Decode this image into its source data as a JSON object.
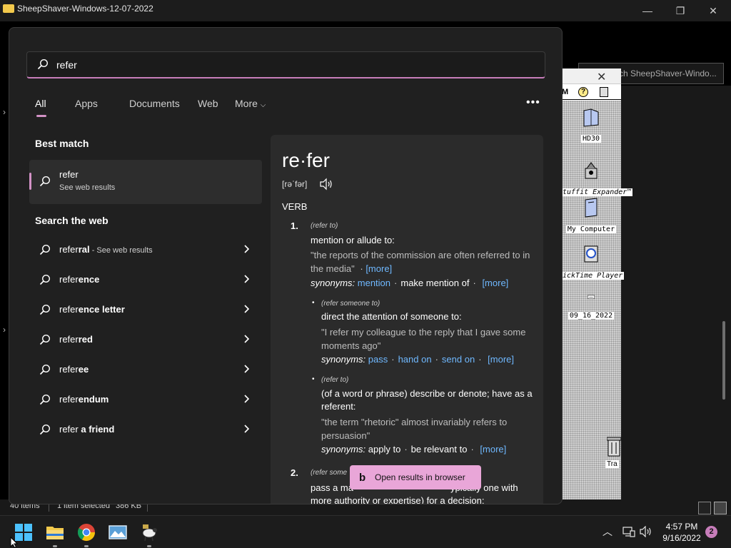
{
  "explorer": {
    "title": "SheepShaver-Windows-12-07-2022",
    "minimize": "—",
    "maximize": "❐",
    "close": "✕",
    "search_placeholder": "rch SheepShaver-Windo...",
    "status_items": "40 items",
    "status_selected": "1 item selected",
    "status_size": "386 KB"
  },
  "mac": {
    "menu_letter": "M",
    "help_glyph": "?",
    "close": "✕",
    "icons": [
      {
        "label": "HD30"
      },
      {
        "label": "tuffit Expander™"
      },
      {
        "label": "My Computer"
      },
      {
        "label": "ickTime Player"
      },
      {
        "label": "09_16_2022"
      }
    ],
    "trash_label": "Tra"
  },
  "search": {
    "query": "refer",
    "tabs": [
      "All",
      "Apps",
      "Documents",
      "Web",
      "More"
    ],
    "more_chevron": "⌵",
    "overflow": "•••",
    "best_match_title": "Best match",
    "best_match": {
      "title": "refer",
      "subtitle": "See web results"
    },
    "web_title": "Search the web",
    "web_items": [
      {
        "prefix": "refer",
        "rest": "ral",
        "sub": " - See web results"
      },
      {
        "prefix": "refer",
        "rest": "ence",
        "sub": ""
      },
      {
        "prefix": "refer",
        "rest": "ence letter",
        "sub": ""
      },
      {
        "prefix": "refer",
        "rest": "red",
        "sub": ""
      },
      {
        "prefix": "refer",
        "rest": "ee",
        "sub": ""
      },
      {
        "prefix": "refer",
        "rest": "endum",
        "sub": ""
      },
      {
        "prefix": "refer",
        "rest": " a friend",
        "sub": ""
      }
    ]
  },
  "dictionary": {
    "word": "re·fer",
    "pronunciation": "[rəˈfər]",
    "part_of_speech": "VERB",
    "sense1_num": "1.",
    "sense1_tag": "(refer to)",
    "sense1_def": "mention or allude to:",
    "sense1_example": "\"the reports of the commission are often referred to in the media\"",
    "more": "[more]",
    "synonyms_label": "synonyms:",
    "sense1_syn": [
      "mention",
      "make mention of"
    ],
    "sub1_tag": "(refer someone to)",
    "sub1_def": "direct the attention of someone to:",
    "sub1_example": "\"I refer my colleague to the reply that I gave some moments ago\"",
    "sub1_syn": [
      "pass",
      "hand on",
      "send on"
    ],
    "sub2_tag": "(refer to)",
    "sub2_def": "(of a word or phrase) describe or denote; have as a referent:",
    "sub2_example": "\"the term \"rhetoric\" almost invariably refers to persuasion\"",
    "sub2_syn": [
      "apply to",
      "be relevant to"
    ],
    "sense2_num": "2.",
    "sense2_tag": "(refer some",
    "sense2_def_a": "pass a ma",
    "sense2_def_b": "ypically one with",
    "sense2_def_c": "more authority or expertise) for a decision:",
    "open_browser": "Open results in browser"
  },
  "taskbar": {
    "time": "4:57 PM",
    "date": "9/16/2022",
    "notifications": "2",
    "tray_chevron": "︿"
  }
}
